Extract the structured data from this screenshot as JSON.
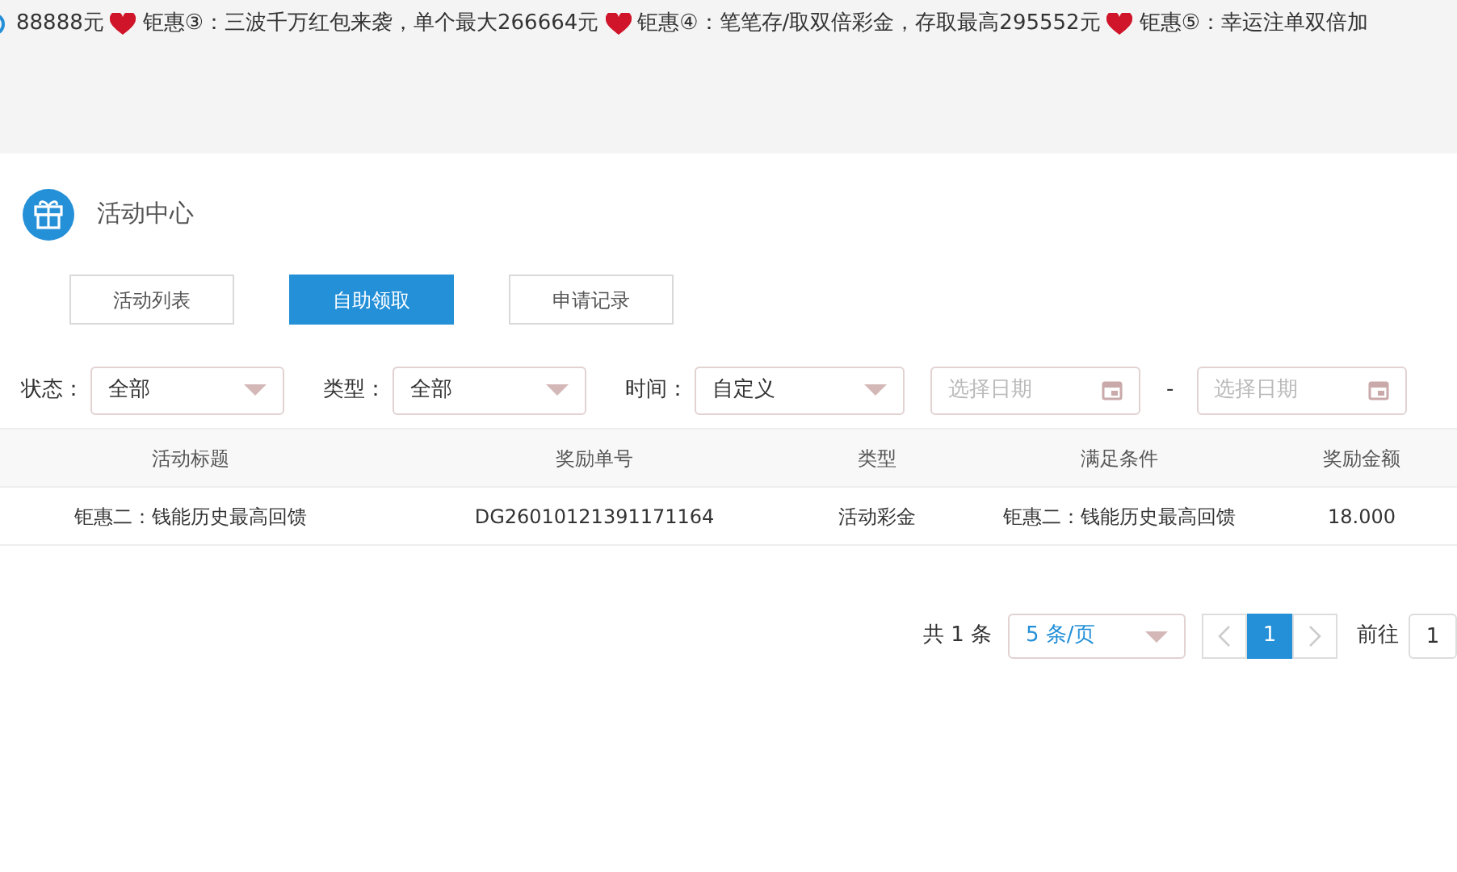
{
  "marquee": {
    "segments": [
      "88888元",
      "钜惠③：三波千万红包来袭，单个最大266664元",
      "钜惠④：笔笔存/取双倍彩金，存取最高295552元",
      "钜惠⑤：幸运注单双倍加"
    ]
  },
  "header": {
    "title": "活动中心"
  },
  "tabs": [
    {
      "label": "活动列表",
      "selected": false
    },
    {
      "label": "自助领取",
      "selected": true
    },
    {
      "label": "申请记录",
      "selected": false
    }
  ],
  "filters": {
    "status": {
      "label": "状态：",
      "value": "全部"
    },
    "type": {
      "label": "类型：",
      "value": "全部"
    },
    "time": {
      "label": "时间：",
      "value": "自定义"
    },
    "date_start": {
      "placeholder": "选择日期"
    },
    "separator": "-",
    "date_end": {
      "placeholder": "选择日期"
    }
  },
  "table": {
    "columns": [
      "活动标题",
      "奖励单号",
      "类型",
      "满足条件",
      "奖励金额"
    ],
    "rows": [
      [
        "钜惠二：钱能历史最高回馈",
        "DG26010121391171164",
        "活动彩金",
        "钜惠二：钱能历史最高回馈",
        "18.000"
      ]
    ]
  },
  "pagination": {
    "total": "共 1 条",
    "page_size": "5 条/页",
    "pages": [
      {
        "label": "1",
        "selected": true
      }
    ],
    "prev_disabled": true,
    "next_disabled": true,
    "goto_label": "前往",
    "goto_value": "1"
  }
}
